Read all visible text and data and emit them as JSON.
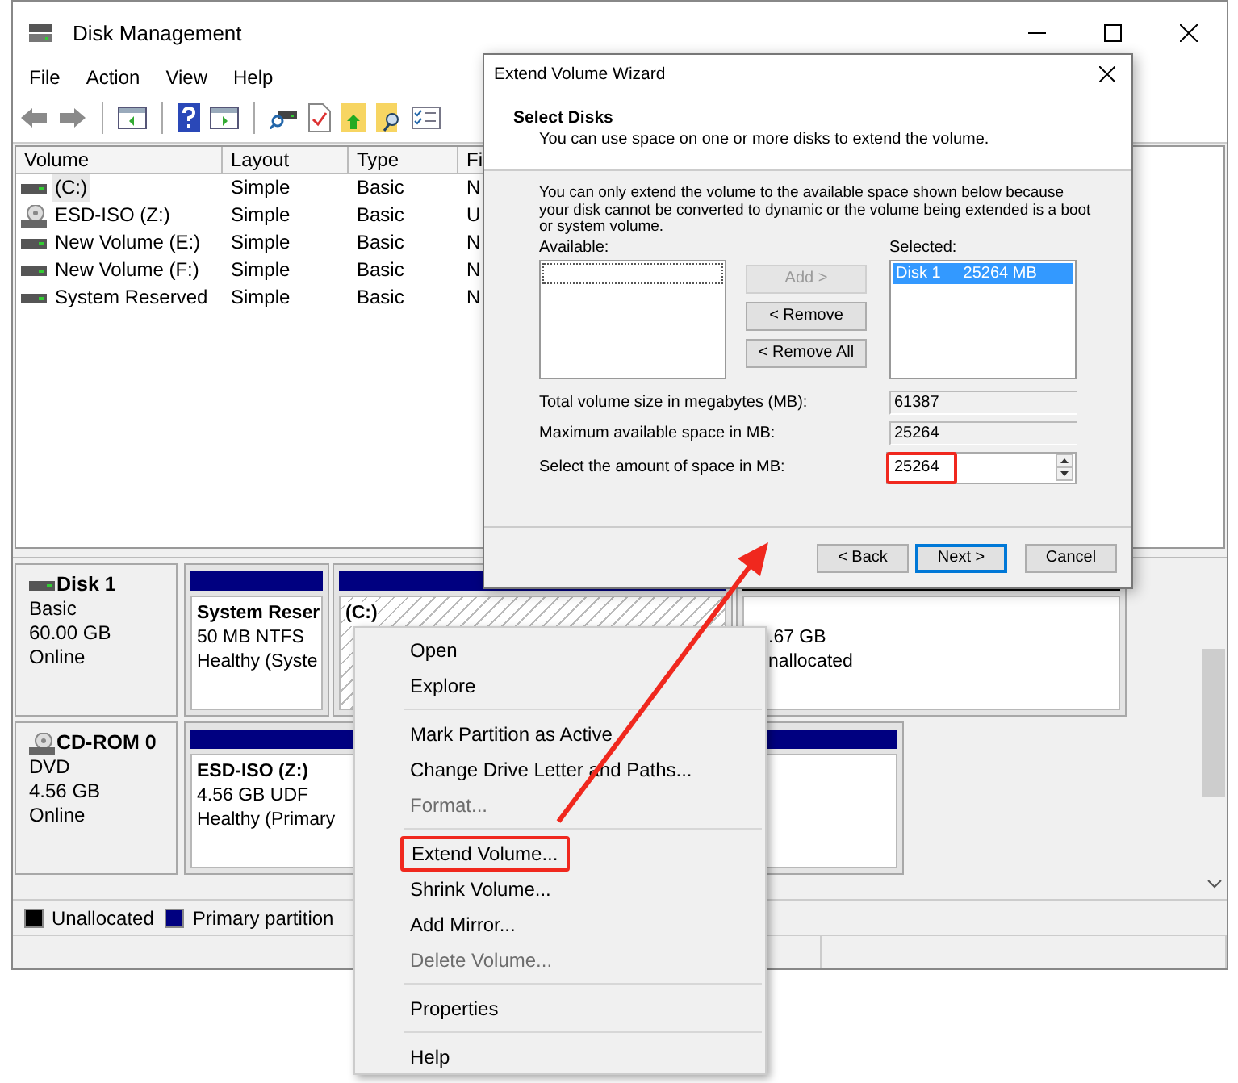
{
  "window": {
    "title": "Disk Management"
  },
  "menu": [
    "File",
    "Action",
    "View",
    "Help"
  ],
  "volume_table": {
    "columns": [
      "Volume",
      "Layout",
      "Type",
      "Fi"
    ],
    "rows": [
      {
        "kind": "disk",
        "selected": true,
        "cells": [
          "(C:)",
          "Simple",
          "Basic",
          "N"
        ]
      },
      {
        "kind": "cd",
        "selected": false,
        "cells": [
          "ESD-ISO (Z:)",
          "Simple",
          "Basic",
          "U"
        ]
      },
      {
        "kind": "disk",
        "selected": false,
        "cells": [
          "New Volume (E:)",
          "Simple",
          "Basic",
          "N"
        ]
      },
      {
        "kind": "disk",
        "selected": false,
        "cells": [
          "New Volume (F:)",
          "Simple",
          "Basic",
          "N"
        ]
      },
      {
        "kind": "disk",
        "selected": false,
        "cells": [
          "System Reserved",
          "Simple",
          "Basic",
          "N"
        ]
      }
    ]
  },
  "disks": [
    {
      "kind": "disk",
      "name": "Disk 1",
      "details": [
        "Basic",
        "60.00 GB",
        "Online"
      ],
      "partitions": [
        {
          "kind": "primary",
          "selected": false,
          "name": "System Reser",
          "lines": [
            "50 MB NTFS",
            "Healthy (Syste"
          ]
        },
        {
          "kind": "primary",
          "selected": true,
          "name": "(C:)"
        },
        {
          "kind": "unallocated",
          "selected": false,
          "lines": [
            ".67 GB",
            "nallocated"
          ]
        }
      ]
    },
    {
      "kind": "cd",
      "name": "CD-ROM 0",
      "details": [
        "DVD",
        "4.56 GB",
        "Online"
      ],
      "partitions": [
        {
          "kind": "primary",
          "selected": false,
          "name": "ESD-ISO  (Z:)",
          "lines": [
            "4.56 GB UDF",
            "Healthy (Primary"
          ]
        }
      ]
    }
  ],
  "legend": [
    {
      "label": "Unallocated",
      "color": "#000000"
    },
    {
      "label": "Primary partition",
      "color": "#000080"
    }
  ],
  "wizard": {
    "title": "Extend Volume Wizard",
    "heading": "Select Disks",
    "subheading": "You can use space on one or more disks to extend the volume.",
    "note": "You can only extend the volume to the available space shown below because your disk cannot be converted to dynamic or the volume being extended is a boot or system volume.",
    "available_label": "Available:",
    "selected_label": "Selected:",
    "move_buttons": [
      {
        "label": "Add >",
        "disabled": true
      },
      {
        "label": "< Remove",
        "disabled": false
      },
      {
        "label": "< Remove All",
        "disabled": false
      }
    ],
    "selected_disks": [
      {
        "disk": "Disk 1",
        "size": "25264 MB",
        "selected": true
      }
    ],
    "fields": [
      {
        "kind": "readonly",
        "label": "Total volume size in megabytes (MB):",
        "value": "61387"
      },
      {
        "kind": "readonly",
        "label": "Maximum available space in MB:",
        "value": "25264"
      },
      {
        "kind": "spin",
        "label": "Select the amount of space in MB:",
        "value": "25264",
        "highlighted": true
      }
    ],
    "buttons": [
      {
        "label": "< Back",
        "default": false
      },
      {
        "label": "Next >",
        "default": true
      },
      {
        "label": "Cancel",
        "default": false
      }
    ]
  },
  "context_menu": [
    {
      "kind": "item",
      "label": "Open",
      "disabled": false,
      "highlighted": false
    },
    {
      "kind": "item",
      "label": "Explore",
      "disabled": false,
      "highlighted": false
    },
    {
      "kind": "separator"
    },
    {
      "kind": "item",
      "label": "Mark Partition as Active",
      "disabled": false,
      "highlighted": false
    },
    {
      "kind": "item",
      "label": "Change Drive Letter and Paths...",
      "disabled": false,
      "highlighted": false
    },
    {
      "kind": "item",
      "label": "Format...",
      "disabled": true,
      "highlighted": false
    },
    {
      "kind": "separator"
    },
    {
      "kind": "item",
      "label": "Extend Volume...",
      "disabled": false,
      "highlighted": true
    },
    {
      "kind": "item",
      "label": "Shrink Volume...",
      "disabled": false,
      "highlighted": false
    },
    {
      "kind": "item",
      "label": "Add Mirror...",
      "disabled": false,
      "highlighted": false
    },
    {
      "kind": "item",
      "label": "Delete Volume...",
      "disabled": true,
      "highlighted": false
    },
    {
      "kind": "separator"
    },
    {
      "kind": "item",
      "label": "Properties",
      "disabled": false,
      "highlighted": false
    },
    {
      "kind": "separator"
    },
    {
      "kind": "item",
      "label": "Help",
      "disabled": false,
      "highlighted": false
    }
  ]
}
